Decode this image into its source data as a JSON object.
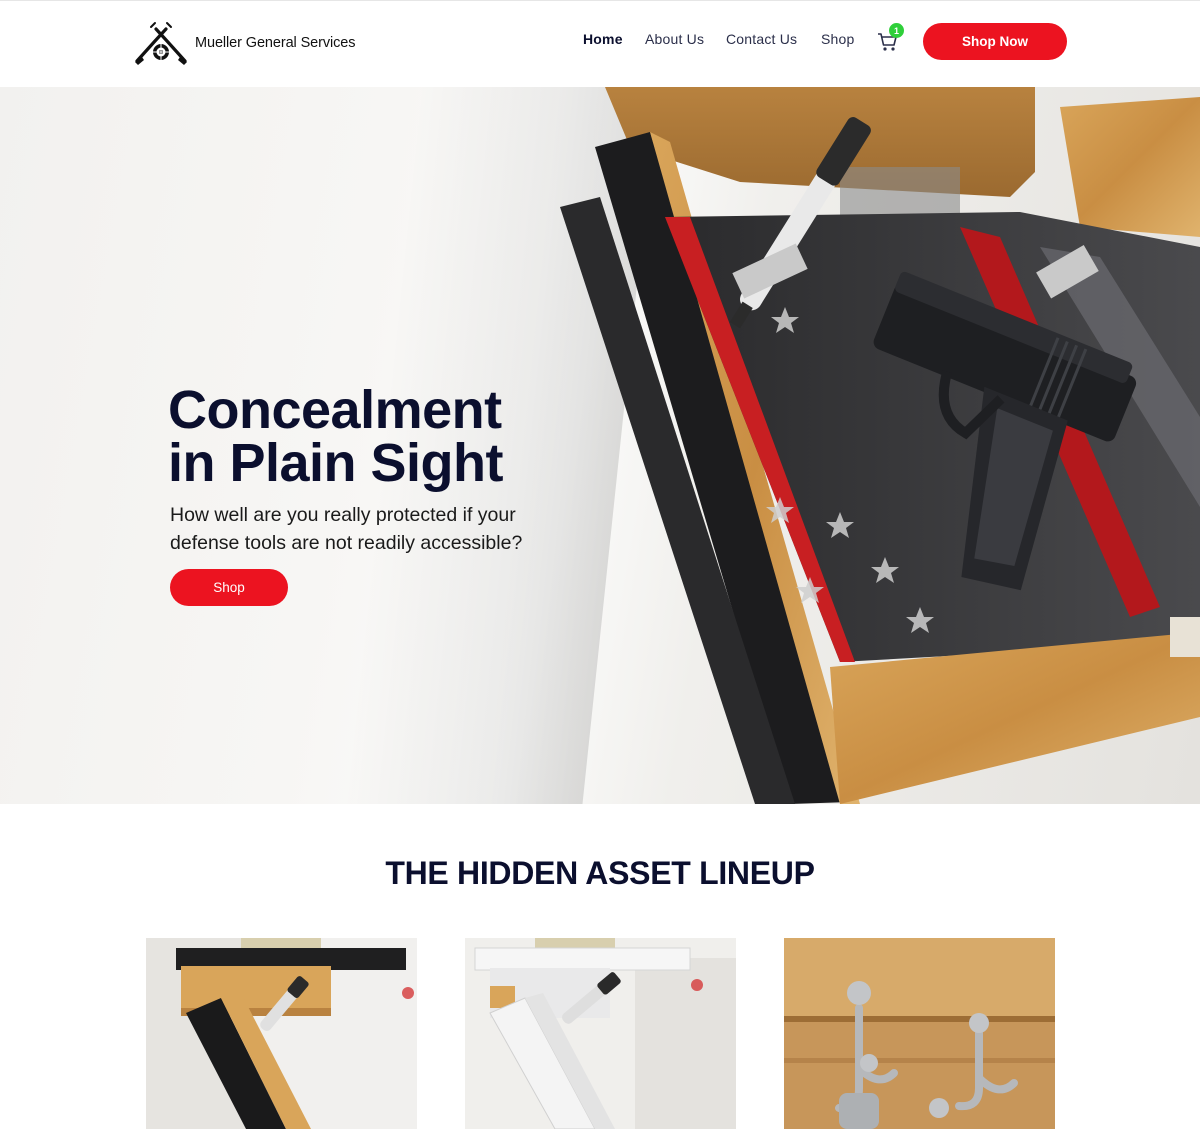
{
  "header": {
    "logo_text": "Mueller General Services",
    "nav": [
      {
        "label": "Home",
        "active": true
      },
      {
        "label": "About Us",
        "active": false
      },
      {
        "label": "Contact Us",
        "active": false
      },
      {
        "label": "Shop",
        "active": false
      }
    ],
    "cart_count": "1",
    "cta_label": "Shop Now"
  },
  "hero": {
    "title_line1": "Concealment",
    "title_line2": "in Plain Sight",
    "subtitle_line1": "How well are you really protected if your",
    "subtitle_line2": "defense tools are not readily accessible?",
    "button_label": "Shop"
  },
  "lineup": {
    "title": "THE HIDDEN ASSET LINEUP"
  },
  "colors": {
    "accent_red": "#ec1320",
    "navy": "#0b0f2e",
    "badge_green": "#2fcf3a"
  }
}
